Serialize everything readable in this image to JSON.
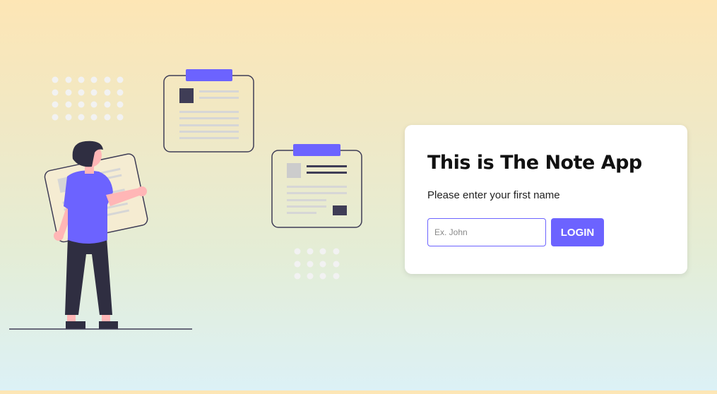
{
  "login": {
    "title": "This is The Note App",
    "prompt": "Please enter your first name",
    "input_placeholder": "Ex. John",
    "input_value": "",
    "button_label": "LOGIN"
  },
  "colors": {
    "accent": "#6c63ff",
    "dark": "#2f2e41",
    "skin": "#ffb6b6",
    "dots": "#f2f2f2"
  },
  "illustration": {
    "subject": "person-holding-note-card",
    "decorations": [
      "dot-grid",
      "note-card",
      "note-card",
      "dot-grid",
      "ground-line"
    ]
  }
}
